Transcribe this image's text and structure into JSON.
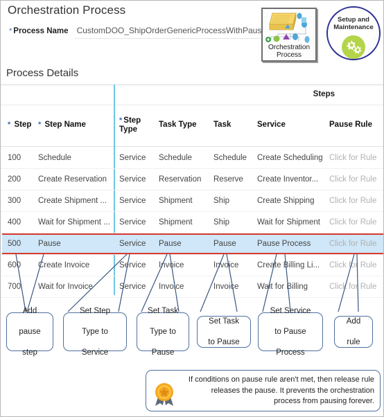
{
  "header": {
    "title": "Orchestration Process",
    "process_name_label": "Process Name",
    "process_name_value": "CustomDOO_ShipOrderGenericProcessWithPause",
    "required_marker": "*"
  },
  "icons": {
    "orchestration": {
      "line1": "Orchestration",
      "line2": "Process",
      "name": "orchestration-process-icon"
    },
    "setup": {
      "line1": "Setup and",
      "line2": "Maintenance",
      "name": "setup-and-maintenance-icon",
      "accent": "#b4d449",
      "ring": "#2e3192"
    }
  },
  "section": {
    "title": "Process Details"
  },
  "table": {
    "group_header": "Steps",
    "columns": [
      {
        "key": "step",
        "label": "Step",
        "required": true
      },
      {
        "key": "step_name",
        "label": "Step Name",
        "required": true
      },
      {
        "key": "step_type",
        "label": "Step\nType",
        "label_line1": "Step",
        "label_line2": "Type",
        "required": true
      },
      {
        "key": "task_type",
        "label": "Task Type",
        "required": false
      },
      {
        "key": "task",
        "label": "Task",
        "required": false
      },
      {
        "key": "service",
        "label": "Service",
        "required": false
      },
      {
        "key": "pause_rule",
        "label": "Pause Rule",
        "required": false
      }
    ],
    "rows": [
      {
        "step": "100",
        "step_name": "Schedule",
        "step_type": "Service",
        "task_type": "Schedule",
        "task": "Schedule",
        "service": "Create Scheduling",
        "pause_rule": "Click for Rule",
        "highlighted": false
      },
      {
        "step": "200",
        "step_name": "Create Reservation",
        "step_type": "Service",
        "task_type": "Reservation",
        "task": "Reserve",
        "service": "Create Inventor...",
        "pause_rule": "Click for Rule",
        "highlighted": false
      },
      {
        "step": "300",
        "step_name": "Create Shipment ...",
        "step_type": "Service",
        "task_type": "Shipment",
        "task": "Ship",
        "service": "Create Shipping",
        "pause_rule": "Click for Rule",
        "highlighted": false
      },
      {
        "step": "400",
        "step_name": "Wait for Shipment ...",
        "step_type": "Service",
        "task_type": "Shipment",
        "task": "Ship",
        "service": "Wait for Shipment",
        "pause_rule": "Click for Rule",
        "highlighted": false
      },
      {
        "step": "500",
        "step_name": "Pause",
        "step_type": "Service",
        "task_type": "Pause",
        "task": "Pause",
        "service": "Pause Process",
        "pause_rule": "Click for Rule",
        "highlighted": true
      },
      {
        "step": "600",
        "step_name": "Create Invoice",
        "step_type": "Service",
        "task_type": "Invoice",
        "task": "Invoice",
        "service": "Create Billing Li...",
        "pause_rule": "Click for Rule",
        "highlighted": false
      },
      {
        "step": "700",
        "step_name": "Wait for Invoice",
        "step_type": "Service",
        "task_type": "Invoice",
        "task": "Invoice",
        "service": "Wait for Billing",
        "pause_rule": "Click for Rule",
        "highlighted": false
      }
    ],
    "highlight_color": "#cfe7f8",
    "highlight_border": "#d63b30",
    "divider_color": "#6ec6e0"
  },
  "callouts": [
    {
      "id": "add-pause-step",
      "lines": [
        "Add",
        "pause",
        "step"
      ]
    },
    {
      "id": "set-step-type",
      "lines": [
        "Set Step",
        "Type to",
        "Service"
      ]
    },
    {
      "id": "set-task-type",
      "lines": [
        "Set Task",
        "Type to",
        "Pause"
      ]
    },
    {
      "id": "set-task",
      "lines": [
        "Set Task",
        "to Pause"
      ]
    },
    {
      "id": "set-service",
      "lines": [
        "Set Service",
        "to Pause",
        "Process"
      ]
    },
    {
      "id": "add-rule",
      "lines": [
        "Add",
        "rule"
      ]
    }
  ],
  "note": {
    "icon": "award-medal-icon",
    "text": "If conditions on pause rule aren't met, then release rule releases the pause. It prevents the orchestration process from pausing forever."
  }
}
